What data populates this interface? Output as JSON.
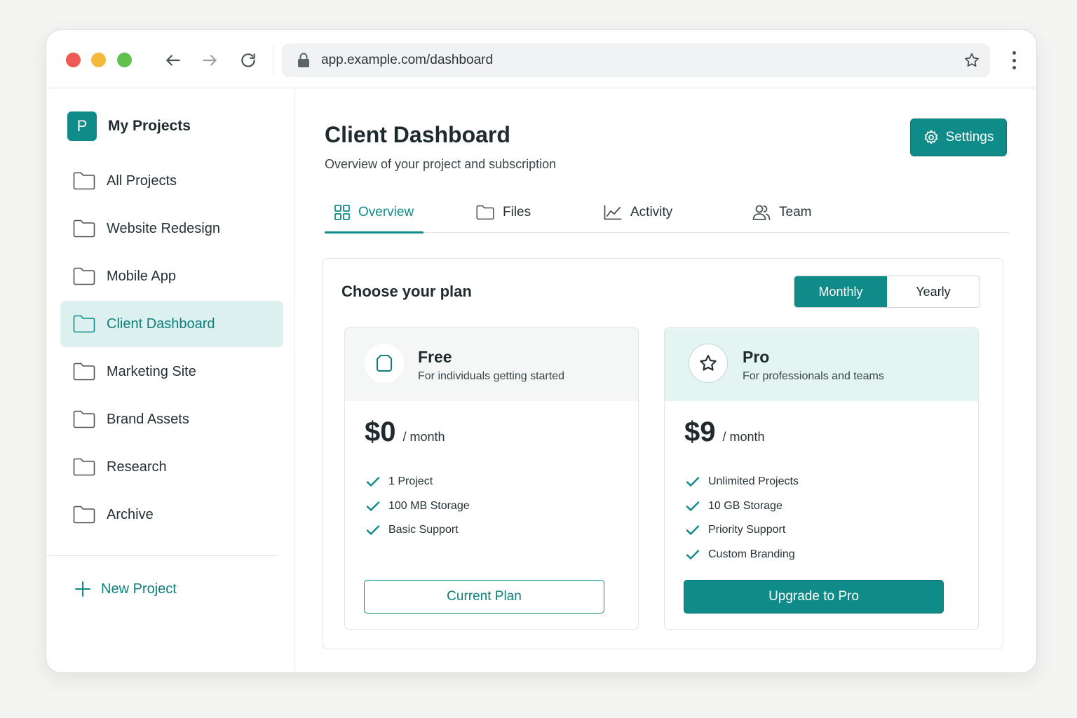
{
  "browser": {
    "url": "app.example.com/dashboard"
  },
  "sidebar": {
    "brand": {
      "initial": "P",
      "name": "My Projects"
    },
    "items": [
      {
        "label": "All Projects",
        "active": false
      },
      {
        "label": "Website Redesign",
        "active": false
      },
      {
        "label": "Mobile App",
        "active": false
      },
      {
        "label": "Client Dashboard",
        "active": true
      },
      {
        "label": "Marketing Site",
        "active": false
      },
      {
        "label": "Brand Assets",
        "active": false
      },
      {
        "label": "Research",
        "active": false
      },
      {
        "label": "Archive",
        "active": false
      }
    ],
    "new_project_label": "New Project"
  },
  "header": {
    "title": "Client Dashboard",
    "subtitle": "Overview of your project and subscription",
    "settings_label": "Settings"
  },
  "tabs": [
    {
      "label": "Overview",
      "icon": "grid-icon",
      "active": true
    },
    {
      "label": "Files",
      "icon": "folder-icon",
      "active": false
    },
    {
      "label": "Activity",
      "icon": "chart-line-icon",
      "active": false
    },
    {
      "label": "Team",
      "icon": "users-icon",
      "active": false
    }
  ],
  "plans": {
    "title": "Choose your plan",
    "billing_toggle": {
      "options": [
        "Monthly",
        "Yearly"
      ],
      "selected": "Monthly"
    },
    "free": {
      "name": "Free",
      "description": "For individuals getting started",
      "price": "$0",
      "period": "/ month",
      "features": [
        "1 Project",
        "100 MB Storage",
        "Basic Support"
      ],
      "button_label": "Current Plan"
    },
    "pro": {
      "name": "Pro",
      "description": "For professionals and teams",
      "price": "$9",
      "period": "/ month",
      "features": [
        "Unlimited Projects",
        "10 GB Storage",
        "Priority Support",
        "Custom Branding"
      ],
      "button_label": "Upgrade to Pro"
    }
  },
  "colors": {
    "accent": "#0f8b8a",
    "active_bg": "#dcf0ef",
    "pro_header_bg": "#e4f4f3"
  }
}
